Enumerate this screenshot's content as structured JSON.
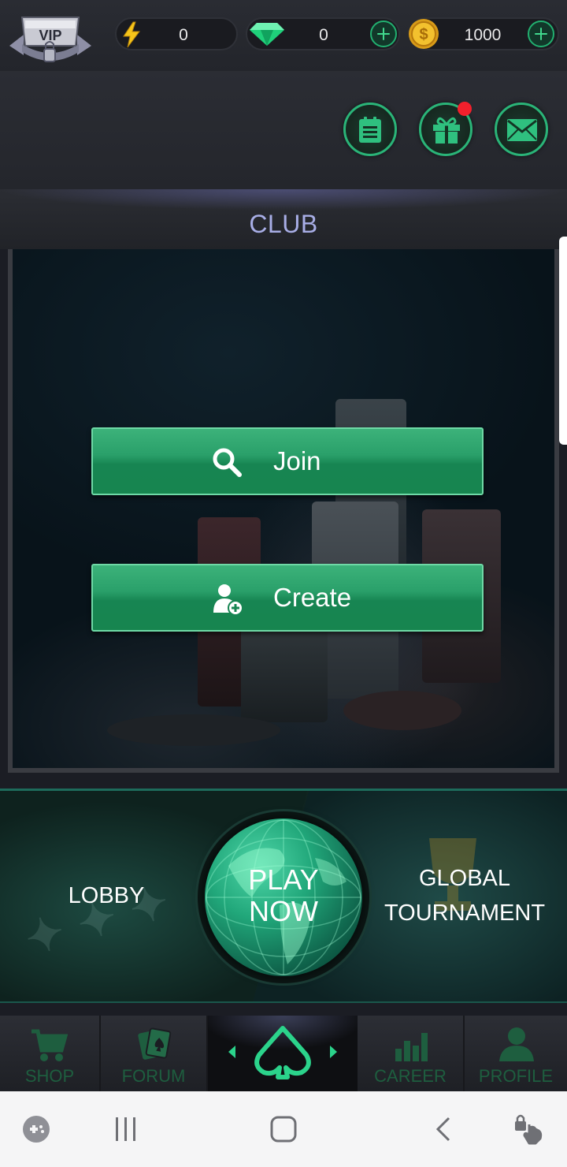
{
  "topbar": {
    "vip_label": "VIP",
    "energy": "0",
    "gems": "0",
    "coins": "1000"
  },
  "club": {
    "title": "CLUB",
    "join_label": "Join",
    "create_label": "Create"
  },
  "modes": {
    "lobby": "LOBBY",
    "play_now": "PLAY\nNOW",
    "global_tournament": "GLOBAL\nTOURNAMENT"
  },
  "nav": {
    "shop": "SHOP",
    "forum": "FORUM",
    "career": "CAREER",
    "profile": "PROFILE"
  },
  "colors": {
    "accent_green": "#2bd38b",
    "button_green": "#1f9560",
    "club_title": "#a8aee6",
    "notification": "#f3202c"
  },
  "icons": [
    "vip-badge-icon",
    "lightning-icon",
    "gem-icon",
    "coin-icon",
    "plus-icon",
    "notes-icon",
    "gift-icon",
    "mail-icon",
    "search-icon",
    "add-user-icon",
    "globe-icon",
    "shop-cart-icon",
    "forum-cards-icon",
    "spade-logo-icon",
    "career-chart-icon",
    "profile-person-icon",
    "game-launcher-icon",
    "recent-apps-icon",
    "home-icon",
    "back-icon",
    "assistant-icon"
  ]
}
